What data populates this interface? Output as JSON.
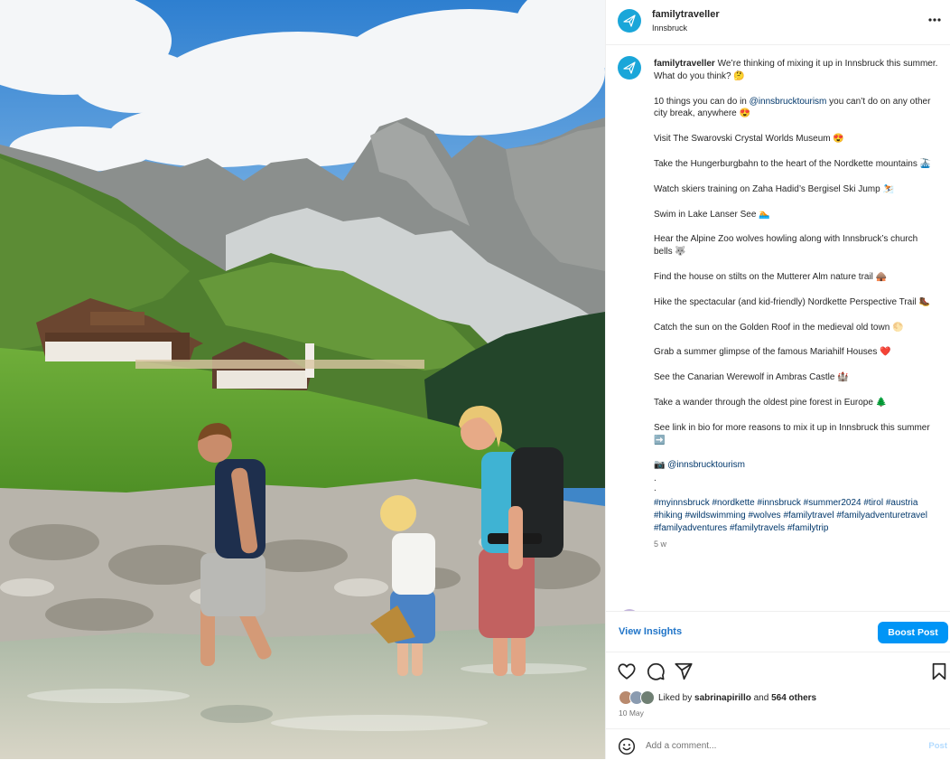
{
  "header": {
    "username": "familytraveller",
    "location": "Innsbruck",
    "more_icon": "more-horizontal-icon"
  },
  "caption": {
    "username": "familytraveller",
    "intro": "We’re thinking of mixing it up in Innsbruck this summer. What do you think? 🤔",
    "para2_before": "10 things you can do in ",
    "mention": "@innsbrucktourism",
    "para2_after": " you can’t do on any other city break, anywhere 😍",
    "items": [
      "Visit The Swarovski Crystal Worlds Museum 😍",
      "Take the Hungerburgbahn to the heart of the Nordkette mountains 🚠",
      "Watch skiers training on Zaha Hadid’s Bergisel Ski Jump ⛷️",
      "Swim in Lake Lanser See 🏊",
      "Hear the Alpine Zoo wolves howling along with Innsbruck’s church bells 🐺",
      "Find the house on stilts on the Mutterer Alm nature trail 🛖",
      "Hike the spectacular (and kid-friendly) Nordkette Perspective Trail 🥾",
      "Catch the sun on the Golden Roof in the medieval old town 🌕",
      "Grab a summer glimpse of the famous Mariahilf Houses ❤️",
      "See the Canarian Werewolf in Ambras Castle 🏰",
      "Take a wander through the oldest pine forest in Europe 🌲",
      "See link in bio for more reasons to mix it up in Innsbruck this summer ➡️"
    ],
    "photo_credit_emoji": "📷",
    "photo_credit": "@innsbrucktourism",
    "dot1": ".",
    "dot2": ".",
    "hashtags": [
      "#myinnsbruck",
      "#nordkette",
      "#innsbruck",
      "#summer2024",
      "#tirol",
      "#austria",
      "#hiking",
      "#wildswimming",
      "#wolves",
      "#familytravel",
      "#familyadventuretravel",
      "#familyadventures",
      "#familytravels",
      "#familytrip"
    ],
    "time_ago": "5 w"
  },
  "insights": {
    "view_label": "View Insights",
    "boost_label": "Boost Post",
    "accent": "#0095f6"
  },
  "actions": {
    "like_icon": "heart-icon",
    "comment_icon": "comment-icon",
    "share_icon": "send-icon",
    "save_icon": "bookmark-icon"
  },
  "likes": {
    "prefix": "Liked by ",
    "user": "sabrinapirillo",
    "middle": " and ",
    "others": "564 others"
  },
  "date": "10 May",
  "comment": {
    "placeholder": "Add a comment...",
    "post_label": "Post",
    "emoji_icon": "emoji-icon"
  }
}
